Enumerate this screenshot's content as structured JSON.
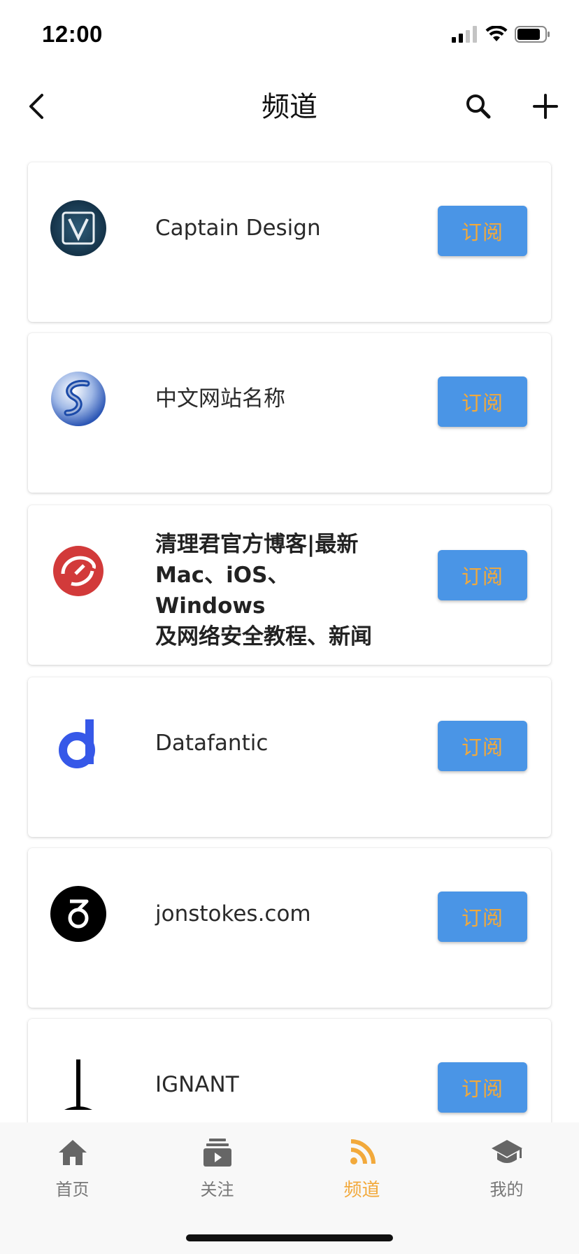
{
  "status_bar": {
    "time": "12:00"
  },
  "nav": {
    "title": "频道"
  },
  "subscribe_label": "订阅",
  "channels": [
    {
      "title": "Captain Design",
      "logo": "captain-design-logo"
    },
    {
      "title": "中文网站名称",
      "logo": "globe-s-logo"
    },
    {
      "title": "清理君官方博客|最新Mac、iOS、Windows及网络安全教程、新闻",
      "logo": "red-circle-logo",
      "lines": [
        "清理君官方博客|最新",
        "Mac、iOS、Windows",
        "及网络安全教程、新闻"
      ]
    },
    {
      "title": "Datafantic",
      "logo": "datafantic-d-logo"
    },
    {
      "title": "jonstokes.com",
      "logo": "jonstokes-logo"
    },
    {
      "title": "IGNANT",
      "logo": "ignant-logo"
    }
  ],
  "tabs": [
    {
      "label": "首页",
      "icon": "home-icon",
      "active": false
    },
    {
      "label": "关注",
      "icon": "subscriptions-icon",
      "active": false
    },
    {
      "label": "频道",
      "icon": "rss-icon",
      "active": true
    },
    {
      "label": "我的",
      "icon": "graduation-cap-icon",
      "active": false
    }
  ],
  "colors": {
    "accent": "#f2a93b",
    "button_bg": "#4a95e6",
    "tab_inactive": "#666666"
  }
}
